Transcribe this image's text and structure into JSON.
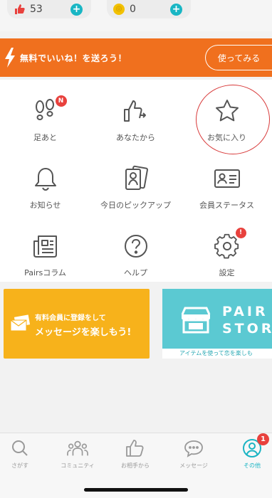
{
  "topbar": {
    "likes_count": "53",
    "coins_count": "0"
  },
  "promo": {
    "text": "無料でいいね！を送ろう！",
    "button_label": "使ってみる"
  },
  "menu": {
    "items": [
      {
        "label": "足あと",
        "badge": "N"
      },
      {
        "label": "あなたから"
      },
      {
        "label": "お気に入り"
      },
      {
        "label": "お知らせ"
      },
      {
        "label": "今日のピックアップ"
      },
      {
        "label": "会員ステータス"
      },
      {
        "label": "Pairsコラム"
      },
      {
        "label": "ヘルプ"
      },
      {
        "label": "設定",
        "badge": "!"
      }
    ]
  },
  "banners": {
    "paid": {
      "line1": "有料会員に登録をして",
      "line2": "メッセージを楽しもう!"
    },
    "store": {
      "title_line1": "PAIR",
      "title_line2": "STOR",
      "caption": "アイテムを使って恋を楽しも"
    }
  },
  "tabs": [
    {
      "label": "さがす"
    },
    {
      "label": "コミュニティ"
    },
    {
      "label": "お相手から"
    },
    {
      "label": "メッセージ"
    },
    {
      "label": "その他",
      "badge": "1"
    }
  ],
  "colors": {
    "accent": "#1ab4c3",
    "promo": "#f0701e",
    "badge": "#e8413d",
    "paid_banner": "#f7b21b",
    "store_banner": "#5bc9d2"
  }
}
